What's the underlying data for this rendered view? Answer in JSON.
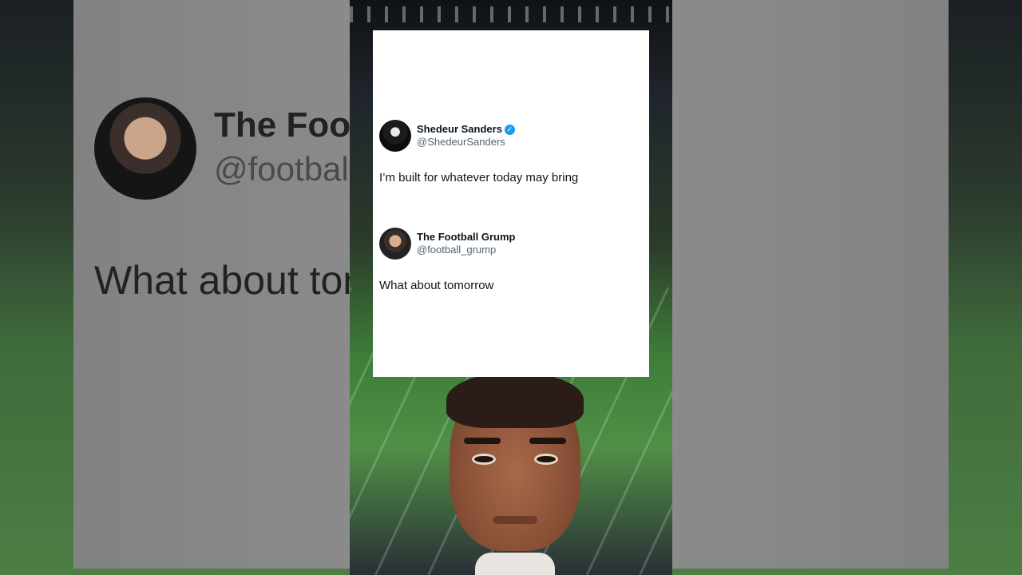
{
  "background": {
    "name": "The Foot",
    "handle": "@footbal",
    "text": "What about tor"
  },
  "tweets": [
    {
      "name": "Shedeur Sanders",
      "handle": "@ShedeurSanders",
      "verified": true,
      "verified_glyph": "✓",
      "text": "I’m built for whatever today may bring"
    },
    {
      "name": "The Football Grump",
      "handle": "@football_grump",
      "verified": false,
      "text": "What about tomorrow"
    }
  ],
  "colors": {
    "verified": "#1d9bf0",
    "text": "#0f1419",
    "handle": "#536471"
  }
}
